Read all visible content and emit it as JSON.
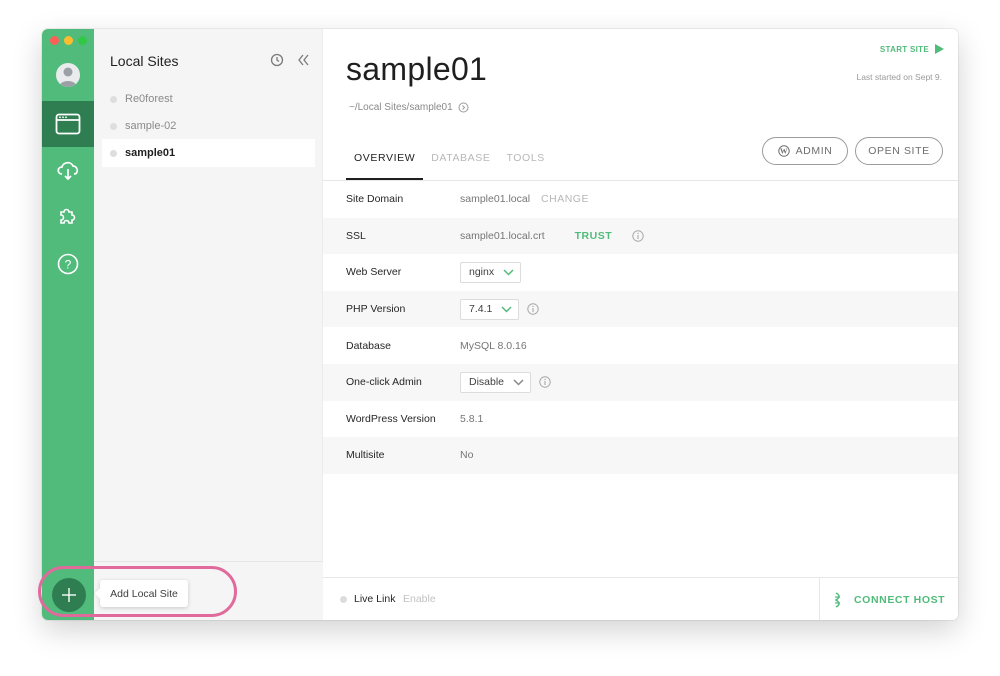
{
  "sidebar": {
    "title": "Local Sites",
    "sites": [
      "Re0forest",
      "sample-02",
      "sample01"
    ],
    "active_site": "sample01",
    "add_tooltip": "Add Local Site"
  },
  "site": {
    "name": "sample01",
    "path": "~/Local Sites/sample01",
    "start_label": "START SITE",
    "last_started": "Last started on Sept 9.",
    "admin_label": "ADMIN",
    "open_site_label": "OPEN SITE"
  },
  "tabs": [
    "OVERVIEW",
    "DATABASE",
    "TOOLS"
  ],
  "details": {
    "site_domain": {
      "label": "Site Domain",
      "value": "sample01.local",
      "action": "CHANGE"
    },
    "ssl": {
      "label": "SSL",
      "value": "sample01.local.crt",
      "action": "TRUST"
    },
    "web_server": {
      "label": "Web Server",
      "value": "nginx"
    },
    "php_version": {
      "label": "PHP Version",
      "value": "7.4.1"
    },
    "database": {
      "label": "Database",
      "value": "MySQL 8.0.16"
    },
    "one_click_admin": {
      "label": "One-click Admin",
      "value": "Disable"
    },
    "wp_version": {
      "label": "WordPress Version",
      "value": "5.8.1"
    },
    "multisite": {
      "label": "Multisite",
      "value": "No"
    }
  },
  "footer": {
    "live_link_label": "Live Link",
    "live_link_action": "Enable",
    "connect_host": "CONNECT HOST"
  },
  "colors": {
    "brand_green": "#51bb7b",
    "brand_dark_green": "#2e7e51",
    "highlight_pink": "#e06a9c"
  },
  "icons": [
    "avatar-icon",
    "sites-icon",
    "cloud-icon",
    "addons-icon",
    "help-icon",
    "history-icon",
    "collapse-icon",
    "wordpress-icon",
    "play-icon",
    "info-icon",
    "chevron-down-icon",
    "plus-icon",
    "connect-host-icon"
  ]
}
